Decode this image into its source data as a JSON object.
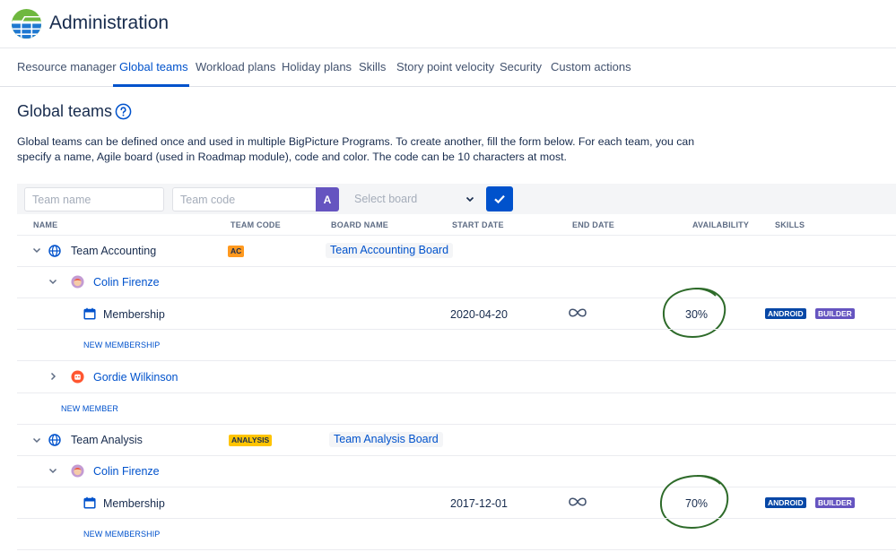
{
  "app": {
    "title": "Administration"
  },
  "tabs": [
    {
      "label": "Resource manager"
    },
    {
      "label": "Global teams"
    },
    {
      "label": "Workload plans"
    },
    {
      "label": "Holiday plans"
    },
    {
      "label": "Skills"
    },
    {
      "label": "Story point velocity"
    },
    {
      "label": "Security"
    },
    {
      "label": "Custom actions"
    }
  ],
  "page": {
    "title": "Global teams",
    "description": "Global teams can be defined once and used in multiple BigPicture Programs. To create another, fill the form below. For each team, you can specify a name, Agile board (used in Roadmap module), code and color. The code can be 10 characters at most."
  },
  "form": {
    "team_name_placeholder": "Team name",
    "team_code_placeholder": "Team code",
    "color_letter": "A",
    "board_placeholder": "Select board"
  },
  "table": {
    "columns": [
      "NAME",
      "TEAM CODE",
      "BOARD NAME",
      "START DATE",
      "END DATE",
      "AVAILABILITY",
      "SKILLS"
    ],
    "teams": [
      {
        "name": "Team Accounting",
        "code": "AC",
        "code_color": "#ff991f",
        "board": "Team Accounting Board",
        "members": [
          {
            "name": "Colin Firenze",
            "memberships": [
              {
                "label": "Membership",
                "start": "2020-04-20",
                "availability": "30%",
                "skills": [
                  "ANDROID",
                  "BUILDER"
                ]
              }
            ],
            "new_membership": "NEW MEMBERSHIP"
          },
          {
            "name": "Gordie Wilkinson"
          }
        ],
        "new_member": "NEW MEMBER"
      },
      {
        "name": "Team Analysis",
        "code": "ANALYSIS",
        "code_color": "#ffc400",
        "board": "Team Analysis Board",
        "members": [
          {
            "name": "Colin Firenze",
            "memberships": [
              {
                "label": "Membership",
                "start": "2017-12-01",
                "availability": "70%",
                "skills": [
                  "ANDROID",
                  "BUILDER"
                ]
              }
            ],
            "new_membership": "NEW MEMBERSHIP"
          }
        ]
      }
    ]
  },
  "colors": {
    "accent": "#0052cc",
    "annotation": "#2e6b2a"
  }
}
